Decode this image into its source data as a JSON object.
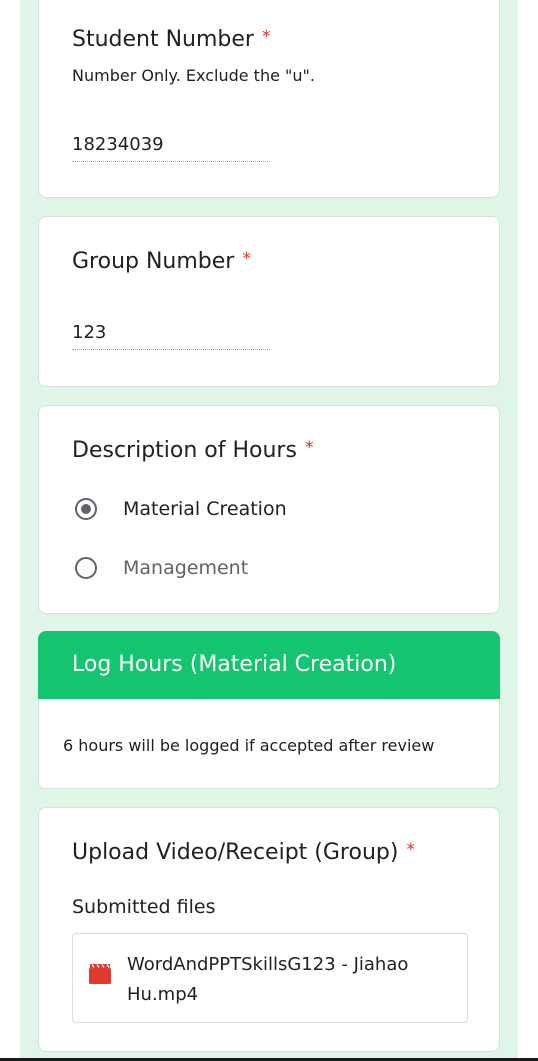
{
  "student_number": {
    "title": "Student Number",
    "required_mark": "*",
    "description": "Number Only. Exclude the \"u\".",
    "value": "18234039"
  },
  "group_number": {
    "title": "Group Number",
    "required_mark": "*",
    "value": "123"
  },
  "description_of_hours": {
    "title": "Description of Hours",
    "required_mark": "*",
    "options": [
      {
        "label": "Material Creation",
        "selected": true
      },
      {
        "label": "Management",
        "selected": false
      }
    ]
  },
  "log_hours_section": {
    "title": "Log Hours (Material Creation)",
    "description": "6 hours will be logged if accepted after review",
    "header_color": "#14c46f"
  },
  "upload": {
    "title": "Upload Video/Receipt (Group)",
    "required_mark": "*",
    "submitted_label": "Submitted files",
    "file": {
      "icon": "video-file-icon",
      "name": "WordAndPPTSkillsG123 - Jiahao Hu.mp4"
    }
  },
  "colors": {
    "background_accent": "#dff5e8",
    "required": "#d93025",
    "section_header": "#14c46f"
  }
}
